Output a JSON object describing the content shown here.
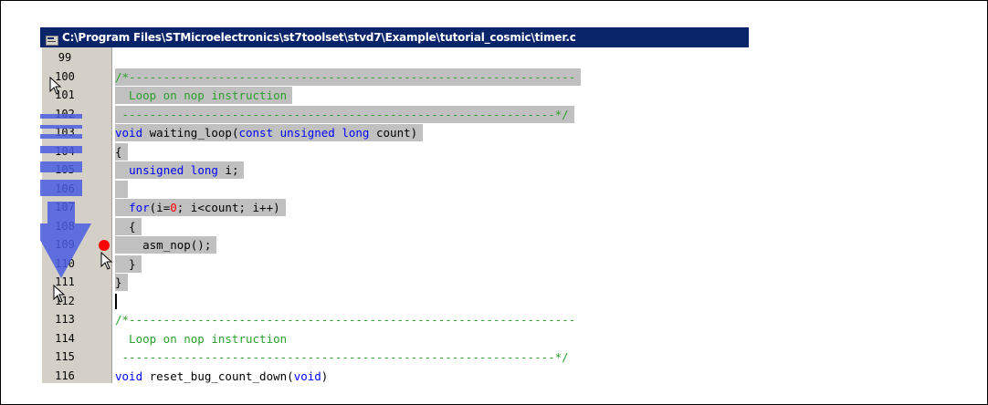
{
  "window": {
    "title": "C:\\Program Files\\STMicroelectronics\\st7toolset\\stvd7\\Example\\tutorial_cosmic\\timer.c"
  },
  "editor": {
    "lines": [
      {
        "num": "99",
        "segments": [],
        "selected": false
      },
      {
        "num": "100",
        "segments": [
          {
            "t": "/*-----------------------------------------------------------------",
            "c": "cm"
          }
        ],
        "selected": true
      },
      {
        "num": "101",
        "segments": [
          {
            "t": "  Loop on nop instruction",
            "c": "cm"
          }
        ],
        "selected": true
      },
      {
        "num": "102",
        "segments": [
          {
            "t": " ---------------------------------------------------------------*/",
            "c": "cm"
          }
        ],
        "selected": true
      },
      {
        "num": "103",
        "segments": [
          {
            "t": "void",
            "c": "kw"
          },
          {
            "t": " waiting_loop(",
            "c": "plain"
          },
          {
            "t": "const unsigned long",
            "c": "kw"
          },
          {
            "t": " count)",
            "c": "plain"
          }
        ],
        "selected": true
      },
      {
        "num": "104",
        "segments": [
          {
            "t": "{",
            "c": "plain"
          }
        ],
        "selected": true
      },
      {
        "num": "105",
        "segments": [
          {
            "t": "  ",
            "c": "plain"
          },
          {
            "t": "unsigned long",
            "c": "kw"
          },
          {
            "t": " i;",
            "c": "plain"
          }
        ],
        "selected": true
      },
      {
        "num": "106",
        "segments": [
          {
            "t": " ",
            "c": "plain"
          }
        ],
        "selected": true
      },
      {
        "num": "107",
        "segments": [
          {
            "t": "  ",
            "c": "plain"
          },
          {
            "t": "for",
            "c": "kw"
          },
          {
            "t": "(i=",
            "c": "plain"
          },
          {
            "t": "0",
            "c": "num"
          },
          {
            "t": "; i<count; i++)",
            "c": "plain"
          }
        ],
        "selected": true
      },
      {
        "num": "108",
        "segments": [
          {
            "t": "  {",
            "c": "plain"
          }
        ],
        "selected": true
      },
      {
        "num": "109",
        "segments": [
          {
            "t": "    asm_nop();",
            "c": "plain"
          }
        ],
        "selected": true,
        "breakpoint": true
      },
      {
        "num": "110",
        "segments": [
          {
            "t": "  }",
            "c": "plain"
          }
        ],
        "selected": true
      },
      {
        "num": "111",
        "segments": [
          {
            "t": "}",
            "c": "plain"
          }
        ],
        "selected": true
      },
      {
        "num": "112",
        "segments": [],
        "selected": false,
        "caret": true
      },
      {
        "num": "113",
        "segments": [
          {
            "t": "/*-----------------------------------------------------------------",
            "c": "cm"
          }
        ],
        "selected": false
      },
      {
        "num": "114",
        "segments": [
          {
            "t": "  Loop on nop instruction",
            "c": "cm"
          }
        ],
        "selected": false
      },
      {
        "num": "115",
        "segments": [
          {
            "t": " ---------------------------------------------------------------*/",
            "c": "cm"
          }
        ],
        "selected": false
      },
      {
        "num": "116",
        "segments": [
          {
            "t": "void",
            "c": "kw"
          },
          {
            "t": " reset_bug_count_down(",
            "c": "plain"
          },
          {
            "t": "void",
            "c": "kw"
          },
          {
            "t": ")",
            "c": "plain"
          }
        ],
        "selected": false
      }
    ]
  },
  "colors": {
    "titlebar": "#0a246a",
    "selection": "#c0c0c0",
    "keyword": "#0000ff",
    "comment": "#2ca02c",
    "number": "#ff0000",
    "breakpoint": "#ff0000",
    "drag_arrow": "#4a5de0"
  },
  "icons": {
    "title_icon": "document-icon",
    "breakpoint": "breakpoint-dot-icon",
    "drag_arrow": "down-arrow-icon",
    "cursor": "mouse-pointer-icon"
  }
}
